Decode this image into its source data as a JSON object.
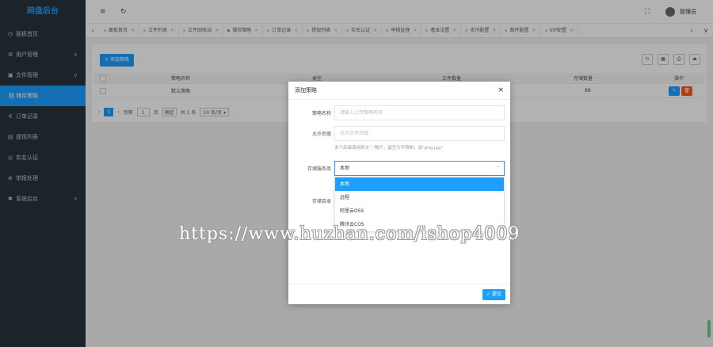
{
  "brand": "网盘后台",
  "sidebar": {
    "items": [
      {
        "label": "面板首页",
        "icon": "◷",
        "chevron": ""
      },
      {
        "label": "用户管理",
        "icon": "⚙",
        "chevron": "∨"
      },
      {
        "label": "文件管理",
        "icon": "▣",
        "chevron": "∨"
      },
      {
        "label": "储存策略",
        "icon": "⛓",
        "chevron": ""
      },
      {
        "label": "订单记录",
        "icon": "⚟",
        "chevron": ""
      },
      {
        "label": "提现列表",
        "icon": "▤",
        "chevron": ""
      },
      {
        "label": "实名认证",
        "icon": "◎",
        "chevron": ""
      },
      {
        "label": "举报处理",
        "icon": "⊛",
        "chevron": ""
      },
      {
        "label": "系统后台",
        "icon": "✱",
        "chevron": "∨"
      }
    ],
    "active_index": 3
  },
  "header": {
    "menu_icon": "≡",
    "refresh_icon": "↻",
    "fullscreen_icon": "⛶",
    "admin_name": "管理员"
  },
  "tabs": {
    "left_arrow": "‹",
    "right_arrow": "›",
    "more": "∨",
    "items": [
      {
        "label": "面板首页",
        "active": false
      },
      {
        "label": "文件列表",
        "active": false
      },
      {
        "label": "文件回收站",
        "active": false
      },
      {
        "label": "储存策略",
        "active": true
      },
      {
        "label": "订单记录",
        "active": false
      },
      {
        "label": "提现列表",
        "active": false
      },
      {
        "label": "实名认证",
        "active": false
      },
      {
        "label": "举报处理",
        "active": false
      },
      {
        "label": "基本设置",
        "active": false
      },
      {
        "label": "支付配置",
        "active": false
      },
      {
        "label": "邮件配置",
        "active": false
      },
      {
        "label": "VIP配置",
        "active": false
      }
    ],
    "close_glyph": "×"
  },
  "toolbar": {
    "add_label": "+ 添加策略",
    "tools": [
      "↻",
      "▦",
      "⎙",
      "⏏"
    ]
  },
  "table": {
    "columns": [
      "策略名称",
      "类型",
      "文件数量",
      "存储数量",
      "操作"
    ],
    "rows": [
      {
        "name": "默认策略",
        "type": "",
        "files": "",
        "storage": "88"
      }
    ],
    "edit_glyph": "✎",
    "delete_glyph": "🗑"
  },
  "pager": {
    "prev": "‹",
    "current": "1",
    "next": "›",
    "goto_prefix": "到第",
    "goto_value": "1",
    "goto_suffix": "页",
    "confirm": "确定",
    "total": "共 1 条",
    "per_page": "10 条/页 ▾"
  },
  "modal": {
    "title": "添加策略",
    "close": "×",
    "fields": {
      "name_label": "策略名称",
      "name_placeholder": "请输入上传策略名称",
      "allow_label": "允许后缀",
      "allow_placeholder": "允许文件后缀",
      "allow_hint": "多个后缀请用英文\",\"隔开，留空为不限制，如\"png,jpg\"",
      "store_label": "存储服务商",
      "store_value": "本地",
      "dir_label": "存储目录"
    },
    "dropdown_options": [
      "本地",
      "远程",
      "阿里云OSS",
      "腾讯云COS"
    ],
    "dropdown_selected": 0,
    "submit_label": "✓ 提交"
  },
  "watermark": "https://www.huzhan.com/ishop4009",
  "colors": {
    "accent": "#1e9fff",
    "sidebar": "#28333e",
    "danger": "#ff5722"
  }
}
